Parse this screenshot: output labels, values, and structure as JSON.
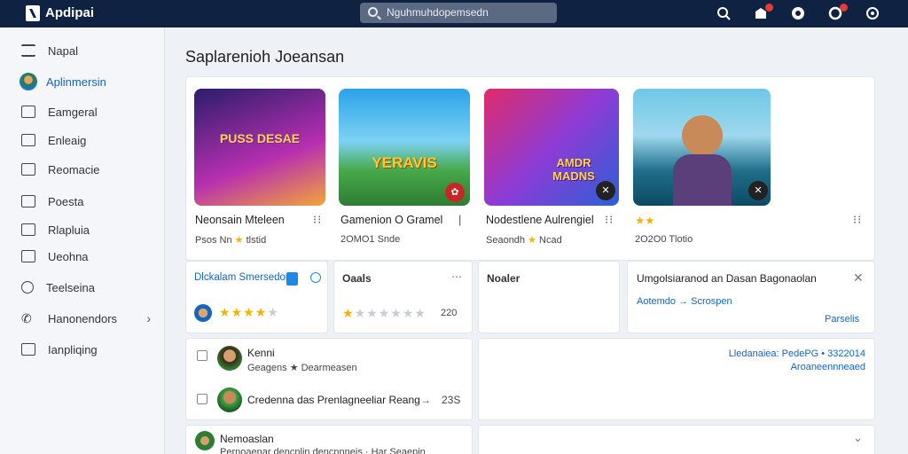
{
  "app": {
    "name": "Apdipai"
  },
  "search": {
    "placeholder": "Nguhmuhdopemsedn"
  },
  "sidebar": {
    "items": [
      {
        "label": "Napal"
      },
      {
        "label": "Aplinmersin"
      },
      {
        "label": "Eamgeral"
      },
      {
        "label": "Enleaig"
      },
      {
        "label": "Reomacie"
      },
      {
        "label": "Poesta"
      },
      {
        "label": "Rlapluia"
      },
      {
        "label": "Ueohna"
      },
      {
        "label": "Teelseina"
      },
      {
        "label": "Hanonendors"
      },
      {
        "label": "Ianpliqing"
      }
    ]
  },
  "main": {
    "title": "Saplarenioh Joeansan"
  },
  "games": [
    {
      "art": "PUSS DESAE",
      "name": "Neonsain Mteleen",
      "sub_left": "Psos Nn",
      "sub_right": "tlstid"
    },
    {
      "art": "YERAVIS",
      "name": "Gamenion O Gramel",
      "sub_left": "2OMO1 Snde",
      "sub_right": ""
    },
    {
      "art": "AMDR MADNS",
      "name": "Nodestlene Aulrengiel",
      "sub_left": "Seaondh",
      "sub_right": "Ncad"
    },
    {
      "art": "",
      "name": "★★",
      "sub_left": "2O2O0 Tlotio",
      "sub_right": ""
    }
  ],
  "widgets": {
    "w1": {
      "title": "Dlckalam Smersedon"
    },
    "w2": {
      "title": "Oaals",
      "count": "220"
    },
    "w3": {
      "title": "Noaler"
    },
    "w4": {
      "title": "Umgolsiaranod an Dasan Bagonaolan",
      "link": "Aotemdo → Scrospen",
      "action": "Parselis"
    }
  },
  "ratings": {
    "w1_filled": 4,
    "w1_total": 5,
    "w2_filled": 1,
    "w2_total": 7
  },
  "list": {
    "row1": {
      "name": "Kenni",
      "sub": "Geagens ★ Dearmeasen"
    },
    "row2": {
      "name": "Credenna das Prenlagneeliar Reang",
      "value": "23S"
    },
    "row3": {
      "name": "Nemoaslan",
      "sub": "Pernoaenar dencnlin dencnnneis · Har Seaepin"
    }
  },
  "right_panel": {
    "line1": "Lledanaiea: PedePG • 3322014",
    "line2": "Aroaneennneaed"
  },
  "colors": {
    "topbar": "#0f2242",
    "accent": "#1565c0",
    "star": "#f5b301"
  }
}
